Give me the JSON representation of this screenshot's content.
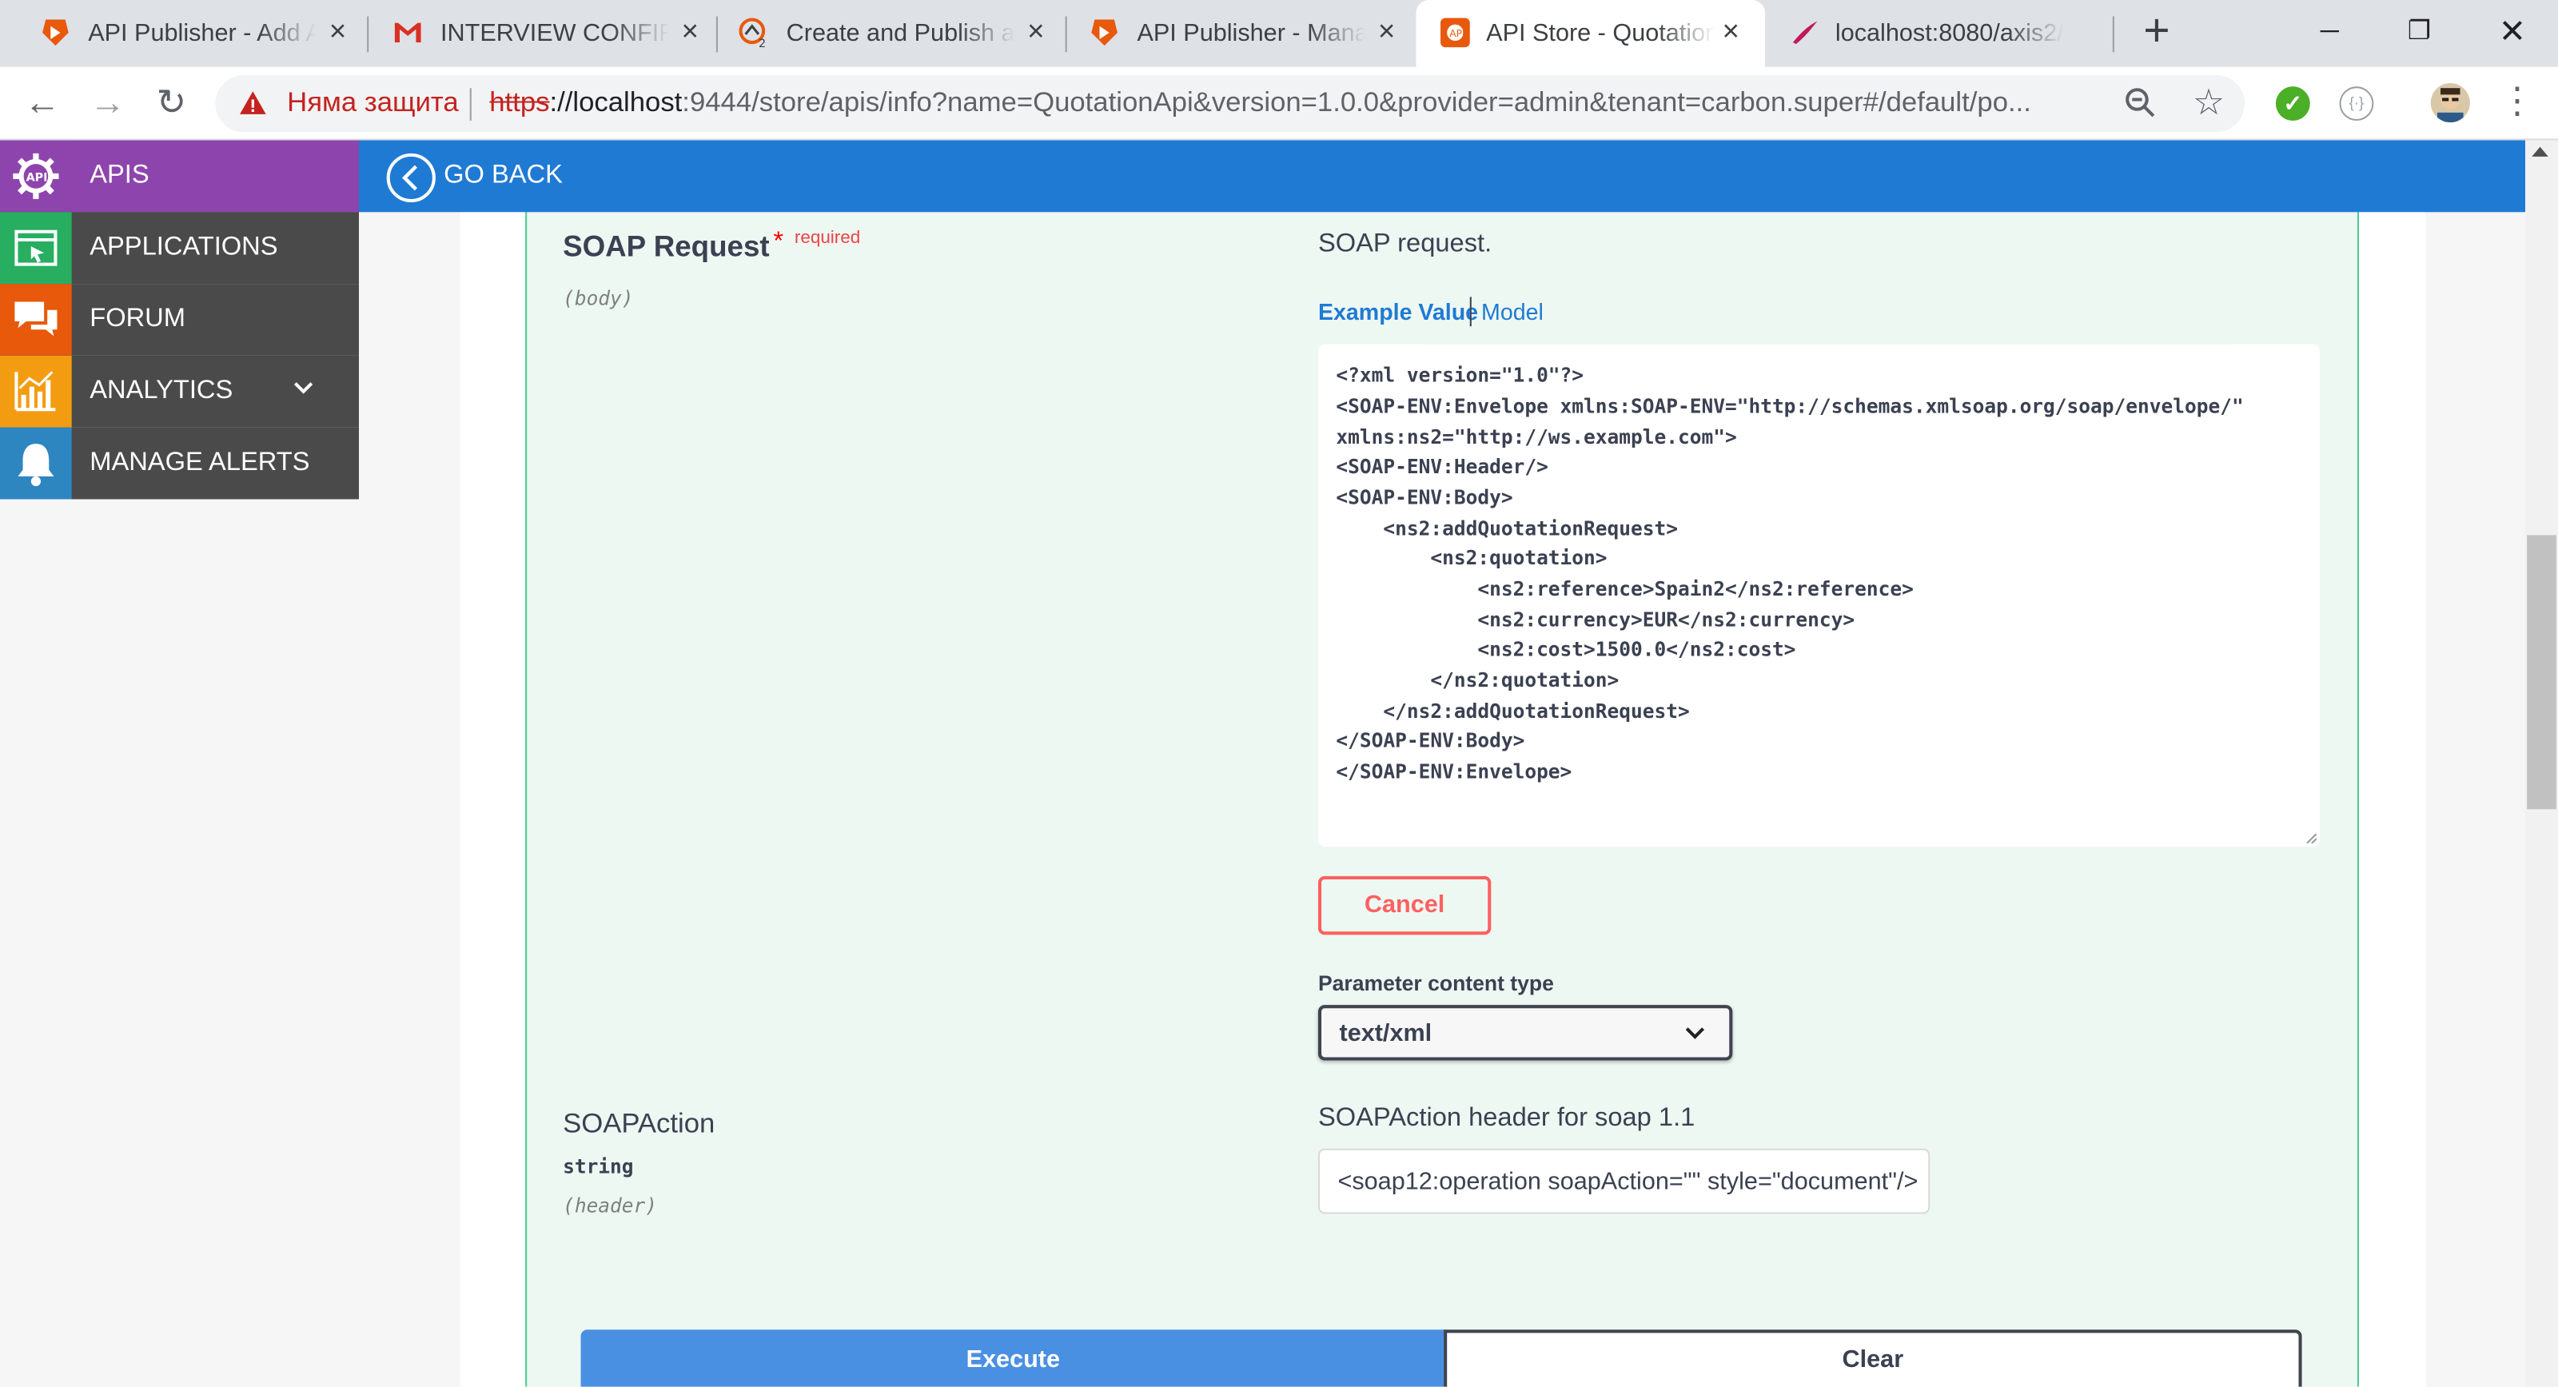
{
  "browser": {
    "tabs": [
      {
        "title": "API Publisher - Add A",
        "active": false
      },
      {
        "title": "INTERVIEW CONFIRM",
        "active": false
      },
      {
        "title": "Create and Publish a",
        "active": false
      },
      {
        "title": "API Publisher - Mana",
        "active": false
      },
      {
        "title": "API Store - Quotation",
        "active": true
      },
      {
        "title": "localhost:8080/axis2/",
        "active": false
      }
    ],
    "security_warning": "Няма защита",
    "url_scheme": "https",
    "url_host": "://localhost",
    "url_rest": ":9444/store/apis/info?name=QuotationApi&version=1.0.0&provider=admin&tenant=carbon.super#/default/po..."
  },
  "topbar": {
    "go_back_label": "GO BACK"
  },
  "sidebar": {
    "items": [
      {
        "label": "APIS",
        "color": "#8e44ad",
        "icon": "gear-api-icon"
      },
      {
        "label": "APPLICATIONS",
        "color": "#27ae60",
        "icon": "application-window-icon"
      },
      {
        "label": "FORUM",
        "color": "#e8590c",
        "icon": "chat-bubbles-icon"
      },
      {
        "label": "ANALYTICS",
        "color": "#f39c12",
        "icon": "bar-chart-icon"
      },
      {
        "label": "MANAGE ALERTS",
        "color": "#2e86c1",
        "icon": "bell-icon"
      }
    ]
  },
  "soap_request": {
    "name": "SOAP Request",
    "required_star": "*",
    "required_label": "required",
    "in": "(body)",
    "description": "SOAP request.",
    "tab_example": "Example Value",
    "tab_model": "Model",
    "example_lines": [
      "<?xml version=\"1.0\"?>",
      "<SOAP-ENV:Envelope xmlns:SOAP-ENV=\"http://schemas.xmlsoap.org/soap/envelope/\"",
      "xmlns:ns2=\"http://ws.example.com\">",
      "<SOAP-ENV:Header/>",
      "<SOAP-ENV:Body>",
      "    <ns2:addQuotationRequest>",
      "        <ns2:quotation>",
      "            <ns2:reference>Spain2</ns2:reference>",
      "            <ns2:currency>EUR</ns2:currency>",
      "            <ns2:cost>1500.0</ns2:cost>",
      "        </ns2:quotation>",
      "    </ns2:addQuotationRequest>",
      "</SOAP-ENV:Body>",
      "</SOAP-ENV:Envelope>"
    ],
    "cancel_label": "Cancel",
    "content_type_label": "Parameter content type",
    "content_type_value": "text/xml"
  },
  "soap_action": {
    "name": "SOAPAction",
    "type": "string",
    "in": "(header)",
    "description": "SOAPAction header for soap 1.1",
    "value": "<soap12:operation soapAction=\"\" style=\"document\"/>"
  },
  "buttons": {
    "execute_label": "Execute",
    "clear_label": "Clear"
  }
}
